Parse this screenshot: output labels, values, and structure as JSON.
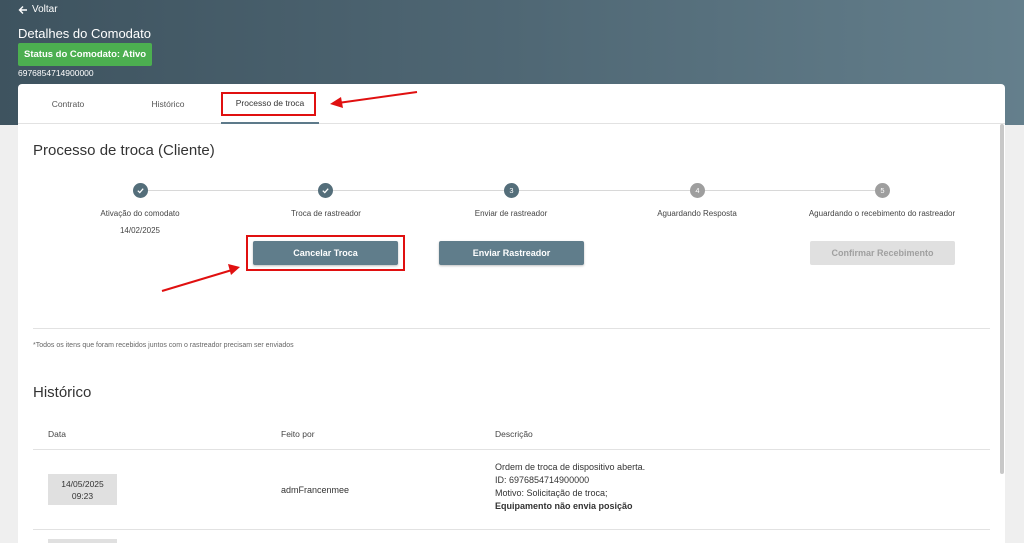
{
  "header": {
    "back_label": "Voltar",
    "title": "Detalhes do Comodato",
    "status_badge": "Status do Comodato: Ativo",
    "contract_id": "6976854714900000"
  },
  "tabs": [
    {
      "label": "Contrato",
      "active": false
    },
    {
      "label": "Histórico",
      "active": false
    },
    {
      "label": "Processo de troca",
      "active": true
    }
  ],
  "process": {
    "title": "Processo de troca (Cliente)",
    "steps": [
      {
        "label": "Ativação do comodato",
        "state": "done",
        "number": "",
        "date": "14/02/2025"
      },
      {
        "label": "Troca de rastreador",
        "state": "done",
        "number": "",
        "date": ""
      },
      {
        "label": "Enviar de rastreador",
        "state": "current",
        "number": "3",
        "date": ""
      },
      {
        "label": "Aguardando Resposta",
        "state": "pending",
        "number": "4",
        "date": ""
      },
      {
        "label": "Aguardando o recebimento do rastreador",
        "state": "pending",
        "number": "5",
        "date": ""
      }
    ],
    "buttons": {
      "cancel": "Cancelar Troca",
      "send": "Enviar Rastreador",
      "confirm": "Confirmar Recebimento"
    },
    "footnote": "*Todos os itens que foram recebidos juntos com o rastreador precisam ser enviados"
  },
  "history": {
    "title": "Histórico",
    "columns": [
      "Data",
      "Feito por",
      "Descrição"
    ],
    "rows": [
      {
        "date": "14/05/2025",
        "time": "09:23",
        "by": "admFrancenmee",
        "description": [
          "Ordem de troca de dispositivo aberta.",
          "ID: 6976854714900000",
          "Motivo: Solicitação de troca;"
        ],
        "description_bold": "Equipamento não envia posição"
      }
    ]
  },
  "colors": {
    "header_gradient_start": "#3e535f",
    "header_gradient_end": "#647f8c",
    "status_green": "#4caf50",
    "primary_button": "#607d8b",
    "annotation_red": "#e01010"
  }
}
